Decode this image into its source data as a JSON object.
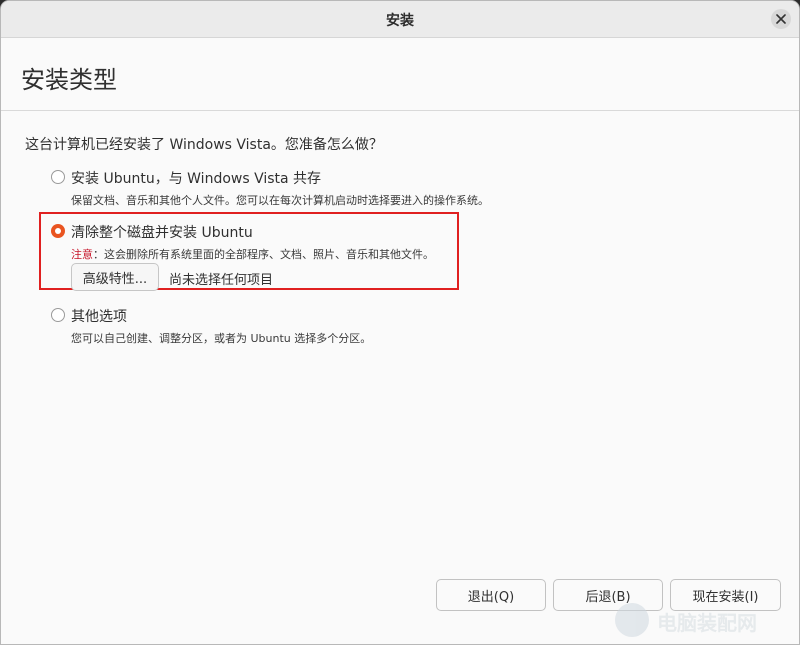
{
  "window": {
    "title": "安装"
  },
  "header": {
    "page_title": "安装类型"
  },
  "question": "这台计算机已经安装了 Windows Vista。您准备怎么做？",
  "options": [
    {
      "label": "安装 Ubuntu，与 Windows Vista 共存",
      "description": "保留文档、音乐和其他个人文件。您可以在每次计算机启动时选择要进入的操作系统。",
      "selected": false
    },
    {
      "label": "清除整个磁盘并安装 Ubuntu",
      "warning_prefix": "注意",
      "description": "：这会删除所有系统里面的全部程序、文档、照片、音乐和其他文件。",
      "selected": true
    },
    {
      "label": "其他选项",
      "description": "您可以自己创建、调整分区，或者为 Ubuntu 选择多个分区。",
      "selected": false
    }
  ],
  "advanced": {
    "button_label": "高级特性...",
    "status": "尚未选择任何项目"
  },
  "buttons": {
    "quit": "退出(Q)",
    "back": "后退(B)",
    "install_now": "现在安装(I)"
  },
  "watermark": {
    "text": "电脑装配网"
  },
  "colors": {
    "accent": "#e95420",
    "warning": "#c7162b",
    "highlight_border": "#e02020"
  },
  "icons": {
    "close": "close-icon"
  }
}
